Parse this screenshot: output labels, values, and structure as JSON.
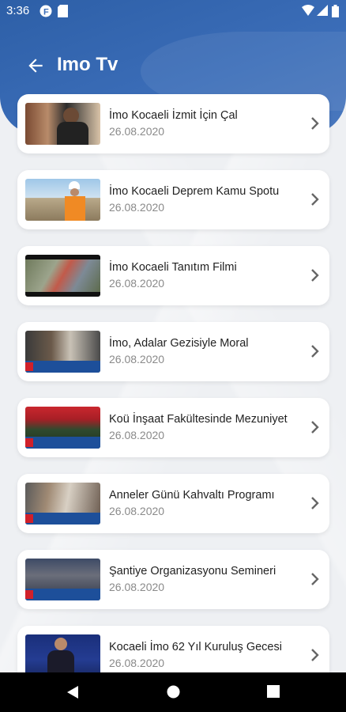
{
  "status": {
    "time": "3:36"
  },
  "header": {
    "title": "Imo Tv"
  },
  "items": [
    {
      "title": "İmo Kocaeli İzmit İçin Çal",
      "date": "26.08.2020"
    },
    {
      "title": "İmo Kocaeli Deprem Kamu Spotu",
      "date": "26.08.2020"
    },
    {
      "title": "İmo Kocaeli Tanıtım Filmi",
      "date": "26.08.2020"
    },
    {
      "title": "İmo, Adalar Gezisiyle Moral",
      "date": "26.08.2020"
    },
    {
      "title": "Koü İnşaat Fakültesinde Mezuniyet",
      "date": "26.08.2020"
    },
    {
      "title": "Anneler Günü Kahvaltı Programı",
      "date": "26.08.2020"
    },
    {
      "title": "Şantiye Organizasyonu Semineri",
      "date": "26.08.2020"
    },
    {
      "title": "Kocaeli İmo 62 Yıl Kuruluş Gecesi",
      "date": "26.08.2020"
    }
  ]
}
